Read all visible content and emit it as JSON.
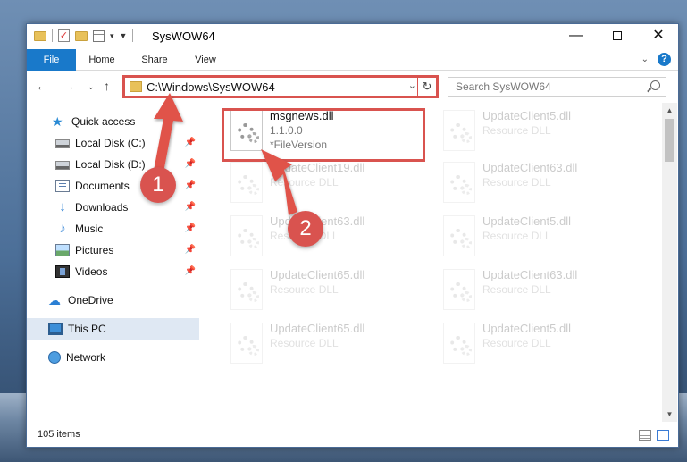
{
  "window": {
    "title": "SysWOW64",
    "minimize_glyph": "—",
    "close_glyph": "✕"
  },
  "ribbon": {
    "tabs": [
      "File",
      "Home",
      "Share",
      "View"
    ]
  },
  "address": {
    "path": "C:\\Windows\\SysWOW64"
  },
  "search": {
    "placeholder": "Search SysWOW64"
  },
  "sidebar": {
    "items": [
      {
        "label": "Quick access",
        "icon": "star-icon"
      },
      {
        "label": "Local Disk (C:)",
        "icon": "drive-icon",
        "pinned": true
      },
      {
        "label": "Local Disk (D:)",
        "icon": "drive-icon",
        "pinned": true
      },
      {
        "label": "Documents",
        "icon": "documents-icon",
        "pinned": true
      },
      {
        "label": "Downloads",
        "icon": "download-icon",
        "pinned": true
      },
      {
        "label": "Music",
        "icon": "music-icon",
        "pinned": true
      },
      {
        "label": "Pictures",
        "icon": "pictures-icon",
        "pinned": true
      },
      {
        "label": "Videos",
        "icon": "videos-icon",
        "pinned": true
      },
      {
        "label": "OneDrive",
        "icon": "cloud-icon"
      },
      {
        "label": "This PC",
        "icon": "pc-icon",
        "selected": true
      },
      {
        "label": "Network",
        "icon": "network-icon"
      }
    ]
  },
  "files": {
    "highlighted": {
      "name": "msgnews.dll",
      "line1": "1.1.0.0",
      "line2": "*FileVersion"
    },
    "left_col": [
      {
        "name": "UpdateClient19.dll",
        "line1": "Resource DLL"
      },
      {
        "name": "UpdateClient63.dll",
        "line1": "Resource DLL"
      },
      {
        "name": "UpdateClient65.dll",
        "line1": "Resource DLL"
      },
      {
        "name": "UpdateClient65.dll",
        "line1": "Resource DLL"
      }
    ],
    "right_col": [
      {
        "name": "UpdateClient5.dll",
        "line1": "Resource DLL"
      },
      {
        "name": "UpdateClient63.dll",
        "line1": "Resource DLL"
      },
      {
        "name": "UpdateClient5.dll",
        "line1": "Resource DLL"
      },
      {
        "name": "UpdateClient63.dll",
        "line1": "Resource DLL"
      },
      {
        "name": "UpdateClient5.dll",
        "line1": "Resource DLL"
      }
    ]
  },
  "status": {
    "item_count": "105 items"
  },
  "annotations": {
    "marker1": "1",
    "marker2": "2",
    "color": "#d9534f"
  }
}
